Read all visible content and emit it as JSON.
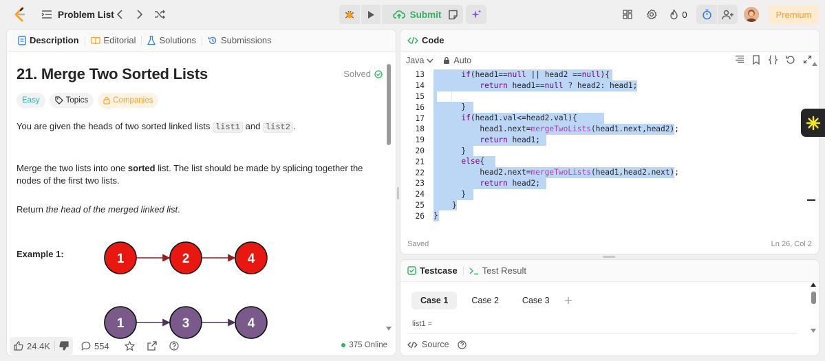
{
  "nav": {
    "problem_list": "Problem List",
    "submit": "Submit",
    "streak_count": "0",
    "premium": "Premium"
  },
  "left_tabs": [
    {
      "label": "Description"
    },
    {
      "label": "Editorial"
    },
    {
      "label": "Solutions"
    },
    {
      "label": "Submissions"
    }
  ],
  "problem": {
    "title": "21. Merge Two Sorted Lists",
    "status": "Solved",
    "difficulty": "Easy",
    "topics": "Topics",
    "companies": "Companies",
    "p1_a": "You are given the heads of two sorted linked lists ",
    "p1_code1": "list1",
    "p1_b": " and ",
    "p1_code2": "list2",
    "p1_c": ".",
    "p2_a": "Merge the two lists into one ",
    "p2_bold": "sorted",
    "p2_b": " list. The list should be made by splicing together the nodes of the first two lists.",
    "p3_a": "Return ",
    "p3_em": "the head of the merged linked list",
    "p3_b": ".",
    "example_title": "Example 1:",
    "list1_nodes": [
      "1",
      "2",
      "4"
    ],
    "list2_nodes": [
      "1",
      "3",
      "4"
    ],
    "colors": {
      "list1": "#e8170f",
      "list2": "#7a5a8a"
    }
  },
  "footer": {
    "likes": "24.4K",
    "comments": "554",
    "online": "375 Online"
  },
  "code": {
    "header": "Code",
    "language": "Java",
    "mode": "Auto",
    "saved": "Saved",
    "position": "Ln 26, Col 2",
    "line_numbers": [
      "13",
      "14",
      "15",
      "16",
      "17",
      "18",
      "19",
      "20",
      "21",
      "22",
      "23",
      "24",
      "25",
      "26"
    ]
  },
  "test": {
    "tab_testcase": "Testcase",
    "tab_result": "Test Result",
    "cases": [
      "Case 1",
      "Case 2",
      "Case 3"
    ],
    "var_label": "list1 =",
    "source": "Source"
  },
  "colors": {
    "accent_green": "#2db55d",
    "premium": "#ffa116",
    "selection": "#bcd6f5"
  }
}
